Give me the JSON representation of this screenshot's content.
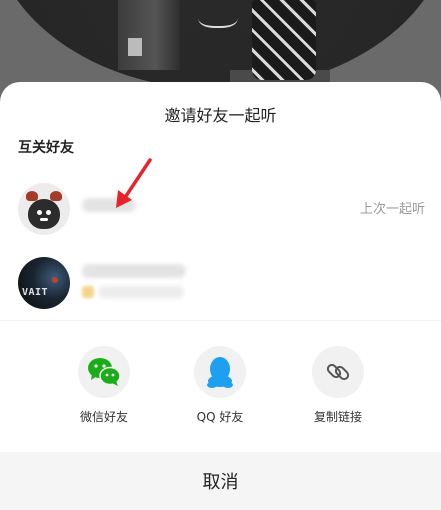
{
  "sheet": {
    "title": "邀请好友一起听",
    "section_title": "互关好友"
  },
  "friends": [
    {
      "avatar": "moose-cartoon-avatar",
      "name_redacted": true,
      "tag": "上次一起听"
    },
    {
      "avatar": "night-street-photo-avatar",
      "avatar_text": "VAIT",
      "name_redacted": true
    }
  ],
  "share": [
    {
      "icon": "wechat-icon",
      "label": "微信好友",
      "color": "#1aad19"
    },
    {
      "icon": "qq-icon",
      "label": "QQ 好友",
      "color": "#1ea0f0"
    },
    {
      "icon": "link-icon",
      "label": "复制链接",
      "color": "#555555"
    }
  ],
  "cancel_label": "取消",
  "colors": {
    "annotation_arrow": "#e8242a",
    "tag_text": "#9a9a9a"
  }
}
